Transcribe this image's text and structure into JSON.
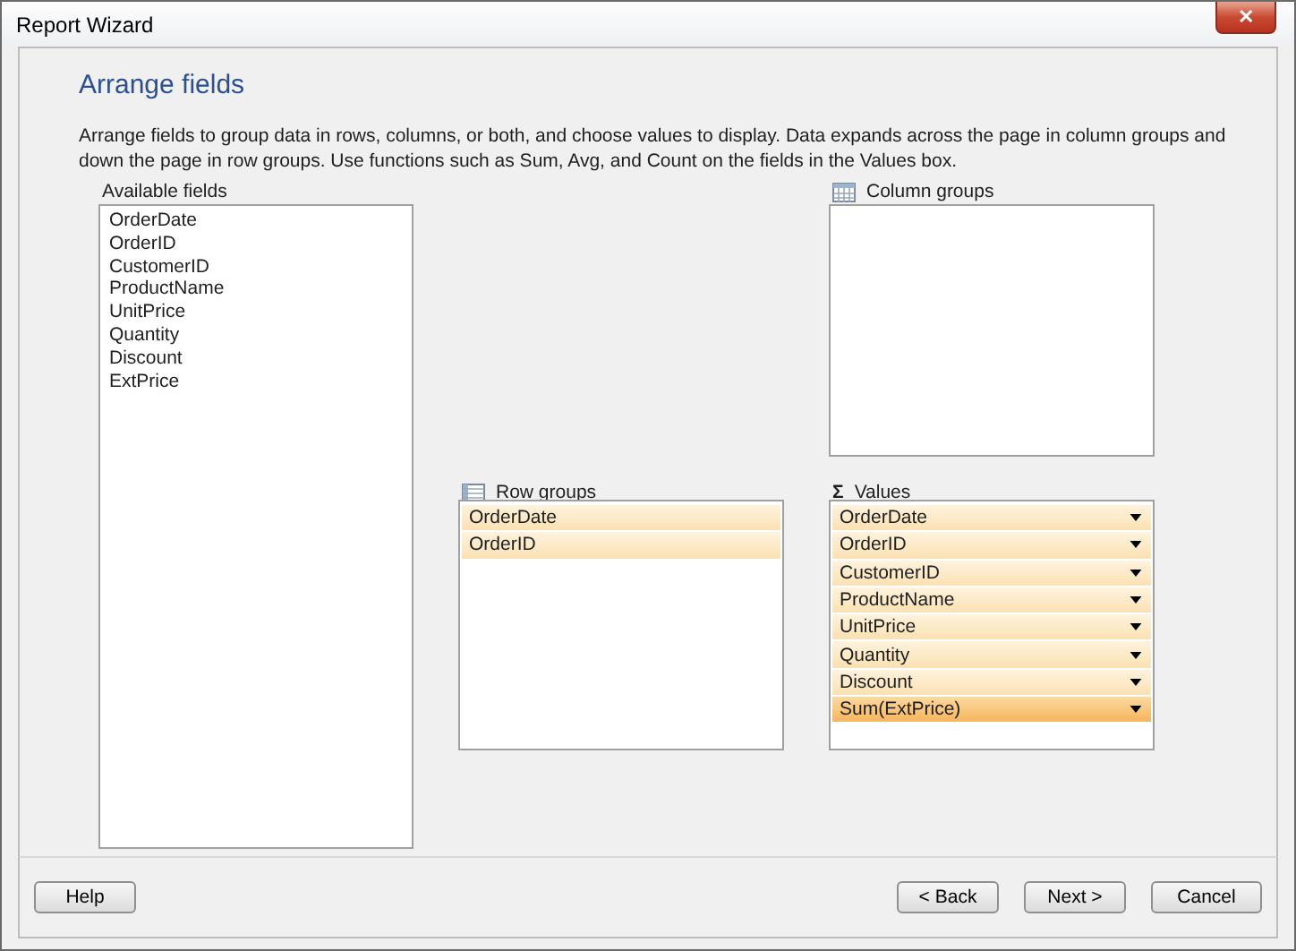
{
  "window": {
    "title": "Report Wizard",
    "close": "✕"
  },
  "heading": "Arrange fields",
  "description": "Arrange fields to group data in rows, columns, or both, and choose values to display. Data expands across the page in column groups and down the page in row groups.  Use functions such as Sum, Avg, and Count on the fields in the Values box.",
  "available_fields": {
    "label": "Available fields",
    "items": [
      "OrderDate",
      "OrderID",
      "CustomerID",
      "ProductName",
      "UnitPrice",
      "Quantity",
      "Discount",
      "ExtPrice"
    ]
  },
  "column_groups": {
    "label": "Column groups"
  },
  "row_groups": {
    "label": "Row groups",
    "items": [
      {
        "text": "OrderDate",
        "selected": false
      },
      {
        "text": "OrderID",
        "selected": false
      }
    ]
  },
  "values": {
    "label": "Values",
    "icon": "Σ",
    "items": [
      {
        "text": "OrderDate",
        "selected": false
      },
      {
        "text": "OrderID",
        "selected": false
      },
      {
        "text": "CustomerID",
        "selected": false
      },
      {
        "text": "ProductName",
        "selected": false
      },
      {
        "text": "UnitPrice",
        "selected": false
      },
      {
        "text": "Quantity",
        "selected": false
      },
      {
        "text": "Discount",
        "selected": false
      },
      {
        "text": "Sum(ExtPrice)",
        "selected": true
      }
    ]
  },
  "buttons": {
    "help": "Help",
    "back": "< Back",
    "next": "Next >",
    "cancel": "Cancel"
  }
}
